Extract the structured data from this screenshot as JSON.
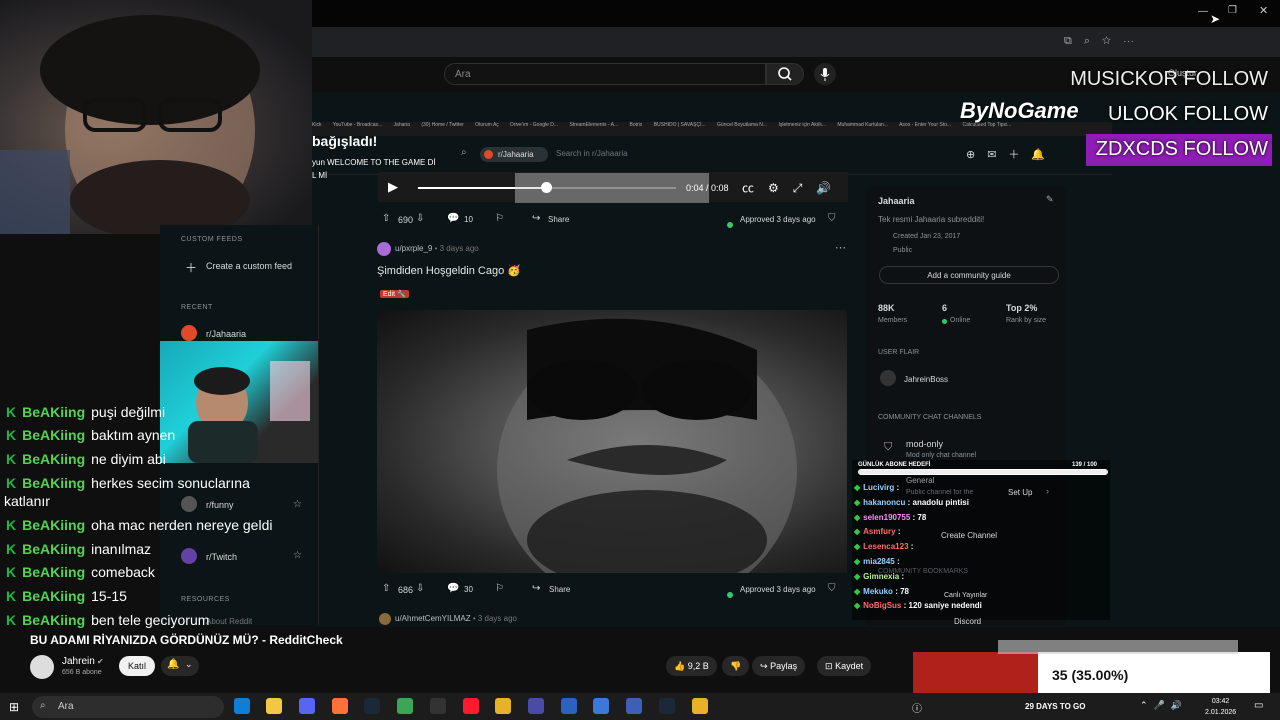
{
  "youtube": {
    "search_placeholder": "Ara",
    "create_label": "Oluştur",
    "video_title": "BU ADAMI RİYANIZDA GÖRDÜNÜZ MÜ? - RedditCheck",
    "channel_name": "Jahrein",
    "subscribers": "656 B abone",
    "join_label": "Katıl",
    "likes": "9,2 B",
    "share_label": "Paylaş",
    "save_label": "Kaydet"
  },
  "stream_overlay": {
    "follow_banners": [
      "MUSICKOR FOLLOW",
      "ULOOK FOLLOW",
      "ZDXCDS FOLLOW"
    ],
    "sponsor": "ByNoGame",
    "donation_header": "bağışladı!",
    "donation_msg": "yun WELCOME TO THE GAME Dİ",
    "donation_msg2": "L Mİ",
    "goal_label": "GÜNLÜK ABONE HEDEFİ",
    "goal_count": "139 / 100",
    "goal_progress": 1.0,
    "percent_label": "35 (35.00%)",
    "days_to_go": "29 DAYS TO GO"
  },
  "chat_left": [
    {
      "user": "BeAKiing",
      "msg": "puşi değilmi"
    },
    {
      "user": "BeAKiing",
      "msg": "baktım aynen"
    },
    {
      "user": "BeAKiing",
      "msg": "ne diyim abi"
    },
    {
      "user": "BeAKiing",
      "msg": "herkes secim sonuclarına"
    },
    {
      "user": "",
      "msg": "katlanır"
    },
    {
      "user": "BeAKiing",
      "msg": "oha mac nerden nereye geldi"
    },
    {
      "user": "BeAKiing",
      "msg": "inanılmaz"
    },
    {
      "user": "BeAKiing",
      "msg": "comeback"
    },
    {
      "user": "BeAKiing",
      "msg": "15-15"
    },
    {
      "user": "BeAKiing",
      "msg": "ben tele geciyorum"
    }
  ],
  "chat_right": [
    {
      "user": "Lucivirg",
      "msg": ":",
      "color": "#8fd3ff"
    },
    {
      "user": "hakanoncu",
      "msg": ": anadolu pintisi",
      "color": "#8fd3ff"
    },
    {
      "user": "selen190755",
      "msg": ": 78",
      "color": "#ff8ef7"
    },
    {
      "user": "Asmfury",
      "msg": ":",
      "color": "#ff6b6b"
    },
    {
      "user": "Lesenca123",
      "msg": ":",
      "color": "#ff6b6b"
    },
    {
      "user": "mia2845",
      "msg": ":",
      "color": "#8fd3ff"
    },
    {
      "user": "Gimnexia",
      "msg": ":",
      "color": "#b8f28e"
    },
    {
      "user": "Mekuko",
      "msg": ": 78",
      "color": "#8fd3ff"
    },
    {
      "user": "NoBigSus",
      "msg": ": 120 saniye nedendi",
      "color": "#ff6b6b"
    }
  ],
  "reddit": {
    "subreddit": "r/Jahaaria",
    "search_placeholder": "Search in r/Jahaaria",
    "bookmarks": [
      "Kick",
      "YouTube - Broadcas...",
      "Jaharia",
      "(30) Home / Twitter",
      "Oturum Aç",
      "Drive'ım - Google D...",
      "StreamElements - A...",
      "Botrix",
      "BUSHIDO | SAVAŞÇI...",
      "Güncel Boyutlama N...",
      "İşletmeniz için Akıllı...",
      "Muhammad Kurtulan...",
      "Asos - Enter Your Sto...",
      "Calculated Top Tipsi..."
    ],
    "video_time": "0:04 / 0:08",
    "post1": {
      "upvotes": "690",
      "comments": "10",
      "share": "Share",
      "approved": "Approved 3 days ago"
    },
    "post2": {
      "author": "u/pxrple_9",
      "age": "• 3 days ago",
      "title": "Şimdiden Hoşgeldin Cago 🥳",
      "flair": "Edit 🔧",
      "upvotes": "686",
      "comments": "30",
      "share": "Share",
      "approved": "Approved 3 days ago"
    },
    "post3": {
      "author": "u/AhmetCemYILMAZ",
      "age": "• 3 days ago"
    },
    "left_sidebar": {
      "custom_feeds": "CUSTOM FEEDS",
      "create_feed": "Create a custom feed",
      "recent": "RECENT",
      "recent_items": [
        "r/Jahaaria",
        "r/funny",
        "r/Twitch"
      ],
      "resources": "RESOURCES",
      "about_reddit": "About Reddit"
    },
    "right_sidebar": {
      "name": "Jahaaria",
      "desc": "Tek resmi Jahaaria subredditi!",
      "created": "Created Jan 23, 2017",
      "visibility": "Public",
      "guide_btn": "Add a community guide",
      "members": "88K",
      "members_label": "Members",
      "online": "6",
      "online_label": "Online",
      "rank": "Top 2%",
      "rank_label": "Rank by size",
      "user_flair": "USER FLAIR",
      "flair_name": "JahreinBoss",
      "chat_channels": "COMMUNITY CHAT CHANNELS",
      "mod_only": "mod-only",
      "mod_only_desc": "Mod only chat channel",
      "general": "General",
      "general_desc": "Public channel for the",
      "setup": "Set Up",
      "create_channel": "Create Channel",
      "bookmarks": "COMMUNITY BOOKMARKS",
      "live": "Canlı Yayınlar",
      "discord": "Discord"
    }
  },
  "taskbar": {
    "search": "Ara",
    "time": "03:42",
    "date": "2.01.2026"
  },
  "colors": {
    "chat_green": "#19b94a",
    "follow_purple": "#8e1db5",
    "pct_red": "#b0211b"
  }
}
